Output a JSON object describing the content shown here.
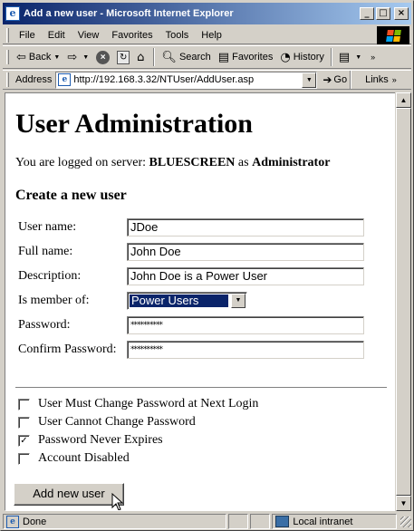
{
  "window": {
    "title": "Add a new user - Microsoft Internet Explorer",
    "app_icon": "ie-page-icon",
    "controls": {
      "minimize": "_",
      "maximize": "□",
      "close": "×"
    }
  },
  "menubar": {
    "items": [
      "File",
      "Edit",
      "View",
      "Favorites",
      "Tools",
      "Help"
    ],
    "brand": "windows-logo-icon",
    "brand_colors": [
      "#f25022",
      "#7fba00",
      "#00a4ef",
      "#ffb900"
    ]
  },
  "toolbar": {
    "back_label": "Back",
    "back_icon": "back-arrow-icon",
    "forward_icon": "forward-arrow-icon",
    "stop_icon": "stop-icon",
    "refresh_icon": "refresh-icon",
    "home_icon": "home-icon",
    "search_label": "Search",
    "favorites_label": "Favorites",
    "history_label": "History",
    "edit_icon": "edit-page-icon"
  },
  "addressbar": {
    "label": "Address",
    "url": "http://192.168.3.32/NTUser/AddUser.asp",
    "go_label": "Go",
    "links_label": "Links"
  },
  "page": {
    "heading": "User Administration",
    "logged_prefix": "You are logged on server: ",
    "server": "BLUESCREEN",
    "logged_mid": " as ",
    "user": "Administrator",
    "section_title": "Create a new user",
    "fields": {
      "username_label": "User name:",
      "username_value": "JDoe",
      "fullname_label": "Full name:",
      "fullname_value": "John Doe",
      "description_label": "Description:",
      "description_value": "John Doe is a Power User",
      "member_label": "Is member of:",
      "member_value": "Power Users",
      "password_label": "Password:",
      "password_value": "**********",
      "confirm_label": "Confirm Password:",
      "confirm_value": "**********"
    },
    "checkboxes": [
      {
        "label": "User Must Change Password at Next Login",
        "checked": false
      },
      {
        "label": "User Cannot Change Password",
        "checked": false
      },
      {
        "label": "Password Never Expires",
        "checked": true
      },
      {
        "label": "Account Disabled",
        "checked": false
      }
    ],
    "submit_label": "Add new user"
  },
  "statusbar": {
    "status_text": "Done",
    "zone_text": "Local intranet"
  }
}
